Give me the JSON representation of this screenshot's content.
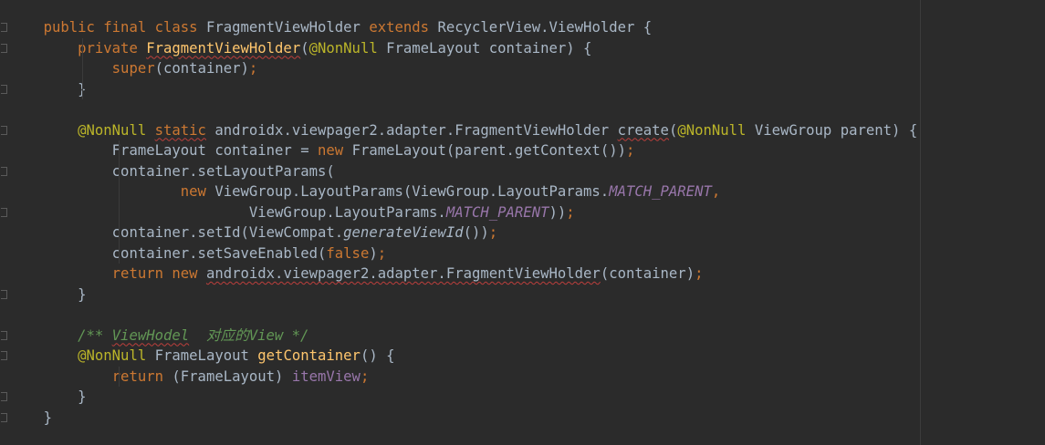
{
  "editor": {
    "colors": {
      "background": "#2b2b2b",
      "text": "#a9b7c6",
      "keyword": "#cc7832",
      "annotation": "#bbb529",
      "method_declaration": "#ffc66d",
      "static_field": "#9876aa",
      "comment": "#629755",
      "error_underline": "#bc3f3c"
    },
    "icons": [
      "fold-marker-icon"
    ],
    "lines": [
      {
        "indent": 0,
        "tokens": [
          {
            "t": "public final class ",
            "c": "kw"
          },
          {
            "t": "FragmentViewHolder ",
            "c": ""
          },
          {
            "t": "extends ",
            "c": "kw"
          },
          {
            "t": "RecyclerView.ViewHolder {",
            "c": ""
          }
        ]
      },
      {
        "indent": 1,
        "tokens": [
          {
            "t": "private ",
            "c": "kw"
          },
          {
            "t": "FragmentViewHolder",
            "c": "fn err"
          },
          {
            "t": "(",
            "c": ""
          },
          {
            "t": "@NonNull ",
            "c": "ann"
          },
          {
            "t": "FrameLayout container) {",
            "c": ""
          }
        ]
      },
      {
        "indent": 2,
        "tokens": [
          {
            "t": "super",
            "c": "kw"
          },
          {
            "t": "(container)",
            "c": ""
          },
          {
            "t": ";",
            "c": "kw"
          }
        ]
      },
      {
        "indent": 1,
        "tokens": [
          {
            "t": "}",
            "c": ""
          }
        ]
      },
      {
        "indent": 0,
        "tokens": []
      },
      {
        "indent": 1,
        "tokens": [
          {
            "t": "@NonNull ",
            "c": "ann"
          },
          {
            "t": "static",
            "c": "kw err"
          },
          {
            "t": " androidx.viewpager2.adapter.FragmentViewHolder ",
            "c": ""
          },
          {
            "t": "create",
            "c": "err"
          },
          {
            "t": "(",
            "c": ""
          },
          {
            "t": "@NonNull ",
            "c": "ann"
          },
          {
            "t": "ViewGroup parent) {",
            "c": ""
          }
        ]
      },
      {
        "indent": 2,
        "tokens": [
          {
            "t": "FrameLayout container = ",
            "c": ""
          },
          {
            "t": "new ",
            "c": "kw"
          },
          {
            "t": "FrameLayout(parent.getContext())",
            "c": ""
          },
          {
            "t": ";",
            "c": "kw"
          }
        ]
      },
      {
        "indent": 2,
        "tokens": [
          {
            "t": "container.setLayoutParams(",
            "c": ""
          }
        ]
      },
      {
        "indent": 4,
        "tokens": [
          {
            "t": "new ",
            "c": "kw"
          },
          {
            "t": "ViewGroup.LayoutParams(ViewGroup.LayoutParams.",
            "c": ""
          },
          {
            "t": "MATCH_PARENT",
            "c": "fld"
          },
          {
            "t": ",",
            "c": "kw"
          }
        ]
      },
      {
        "indent": 6,
        "tokens": [
          {
            "t": "ViewGroup.LayoutParams.",
            "c": ""
          },
          {
            "t": "MATCH_PARENT",
            "c": "fld"
          },
          {
            "t": "))",
            "c": ""
          },
          {
            "t": ";",
            "c": "kw"
          }
        ]
      },
      {
        "indent": 2,
        "tokens": [
          {
            "t": "container.setId(ViewCompat.",
            "c": ""
          },
          {
            "t": "generateViewId",
            "c": "sit"
          },
          {
            "t": "())",
            "c": ""
          },
          {
            "t": ";",
            "c": "kw"
          }
        ]
      },
      {
        "indent": 2,
        "tokens": [
          {
            "t": "container.setSaveEnabled(",
            "c": ""
          },
          {
            "t": "false",
            "c": "kw"
          },
          {
            "t": ")",
            "c": ""
          },
          {
            "t": ";",
            "c": "kw"
          }
        ]
      },
      {
        "indent": 2,
        "tokens": [
          {
            "t": "return new ",
            "c": "kw"
          },
          {
            "t": "androidx.viewpager2.adapter.FragmentViewHolder",
            "c": "err"
          },
          {
            "t": "(container)",
            "c": ""
          },
          {
            "t": ";",
            "c": "kw"
          }
        ]
      },
      {
        "indent": 1,
        "tokens": [
          {
            "t": "}",
            "c": ""
          }
        ]
      },
      {
        "indent": 0,
        "tokens": []
      },
      {
        "indent": 1,
        "tokens": [
          {
            "t": "/** ",
            "c": "cmt"
          },
          {
            "t": "ViewHodel",
            "c": "cmt err"
          },
          {
            "t": "  对应的View */",
            "c": "cmt"
          }
        ]
      },
      {
        "indent": 1,
        "tokens": [
          {
            "t": "@NonNull ",
            "c": "ann"
          },
          {
            "t": "FrameLayout ",
            "c": ""
          },
          {
            "t": "getContainer",
            "c": "fn"
          },
          {
            "t": "() {",
            "c": ""
          }
        ]
      },
      {
        "indent": 2,
        "tokens": [
          {
            "t": "return ",
            "c": "kw"
          },
          {
            "t": "(FrameLayout) ",
            "c": ""
          },
          {
            "t": "itemView",
            "c": "fvar"
          },
          {
            "t": ";",
            "c": "kw"
          }
        ]
      },
      {
        "indent": 1,
        "tokens": [
          {
            "t": "}",
            "c": ""
          }
        ]
      },
      {
        "indent": 0,
        "tokens": [
          {
            "t": "}",
            "c": ""
          }
        ]
      }
    ]
  }
}
